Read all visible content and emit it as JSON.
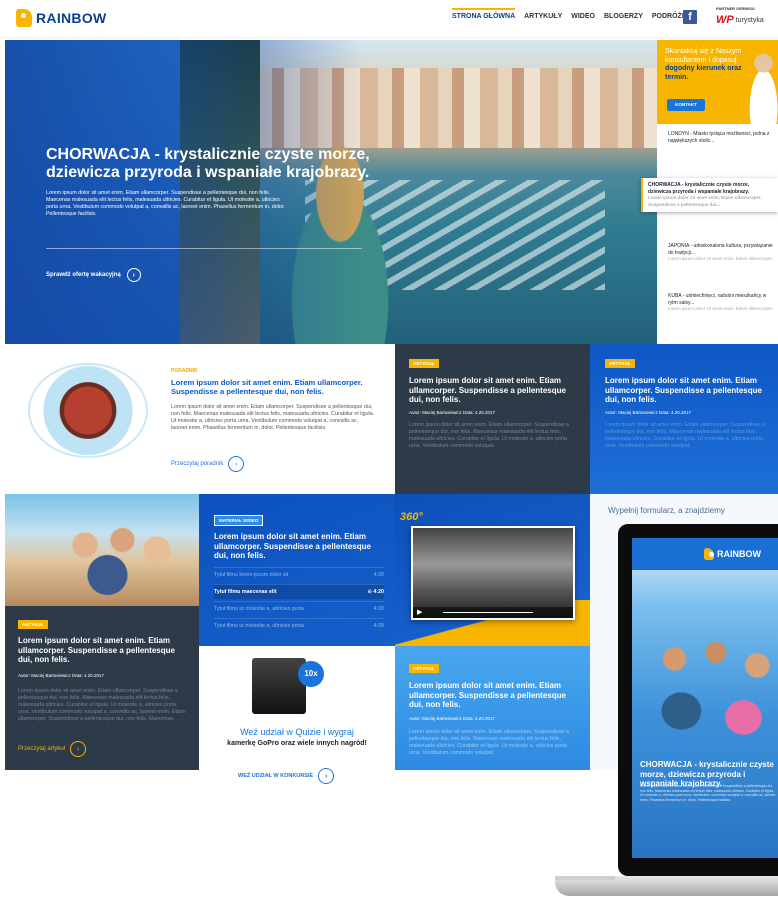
{
  "header": {
    "brand": "RAINBOW",
    "nav": [
      "STRONA GŁÓWNA",
      "ARTYKUŁY",
      "WIDEO",
      "BLOGERZY",
      "PODRÓŻE"
    ],
    "facebook": "f",
    "partner_label": "PARTNER SERWISU",
    "partner_logo": "WP",
    "partner_name": "turystyka"
  },
  "hero": {
    "title": "CHORWACJA - krystalicznie czyste morze, dziewicza przyroda i wspaniałe krajobrazy.",
    "text": "Lorem ipsum dolor sit amet enim. Etiam ullamcorper. Suspendisse a pellentesque dui, non felis. Maecenas malesuada elit lectus felis, malesuada ultricies. Curabitur et ligula. Ut molestie a, ultricies porta urna. Vestibulum commodo volutpat a, convallis ac, laoreet enim. Phasellus fermentum in, dolor. Pellentesque facilisis.",
    "cta": "Sprawdź ofertę wakacyjną",
    "arrow": "›"
  },
  "side": {
    "promo_line1": "Skontaktuj się z Naszym konsultantem i dopasuj",
    "promo_bold": "dogodny kierunek oraz termin.",
    "contact_button": "KONTAKT",
    "items": [
      {
        "title": "LONDYN - Miasto tysiąca możliwości, jedna z największych stolic...",
        "text": ""
      },
      {
        "title": "CHORWACJA - krystalicznie czyste morze, dziewicza przyroda i wspaniałe krajobrazy.",
        "text": "Lorem ipsum dolor sit amet enim. Etiam ullamcorper. Suspendisse a pellentesque dui..."
      },
      {
        "title": "JAPONIA - udoskonalona kultura, przywiązanie do tradycji...",
        "text": "Lorem ipsum dolor sit amet enim. Etiam ullamcorper."
      },
      {
        "title": "KUBA - uśmiechnięci, radośni mieszkańcy w rytm salsy...",
        "text": "Lorem ipsum dolor sit amet enim. Etiam ullamcorper."
      }
    ]
  },
  "guide": {
    "tag": "PORADNIK",
    "title": "Lorem ipsum dolor sit amet enim. Etiam ullamcorper. Suspendisse a pellentesque dui, non felis.",
    "text": "Lorem ipsum dolor sit amet enim. Etiam ullamcorper. Suspendisse a pellentesque dui, non felis. Maecenas malesuada elit lectus felis, malesuada ultricies. Curabitur et ligula. Ut molestie a, ultricies porta urna. Vestibulum commodo volutpat a, convallis ac, laoreet enim. Phasellus fermentum in, dolor. Pellentesque facilisis.",
    "link": "Przeczytaj poradnik",
    "arrow": "›"
  },
  "article": {
    "tag": "ARTYKUŁ",
    "title": "Lorem ipsum dolor sit amet enim. Etiam ullamcorper. Suspendisse a pellentesque dui, non felis.",
    "meta": "Autor: Maciej Bartosiewicz    Data: 4.20.2017",
    "text": "Lorem ipsum dolor sit amet enim. Etiam ullamcorper. Suspendisse a pellentesque dui, non felis. Maecenas malesuada elit lectus felis, malesuada ultricies. Curabitur et ligula. Ut molestie a, ultricies porta urna. Vestibulum commodo volutpat.",
    "text_long": "Lorem ipsum dolor sit amet enim. Etiam ullamcorper. Suspendisse a pellentesque dui, non felis. Maecenas malesuada elit lectus felis, malesuada ultricies. Curabitur et ligula. Ut molestie a, ultricies porta urna. Vestibulum commodo volutpat a, convallis ac, laoreet enim. Etiam ullamcorper. Suspendisse a pellentesque dui, non felis. Maecenas.",
    "link": "Przeczytaj artykuł",
    "arrow": "›"
  },
  "video": {
    "tag": "MATERIAŁ WIDEO",
    "title": "Lorem ipsum dolor sit amet enim. Etiam ullamcorper. Suspendisse a pellentesque dui, non felis.",
    "list": [
      {
        "title": "Tytuł filmu lorem ipsum dolor sit",
        "time": "4:20"
      },
      {
        "title": "Tytuł filmu maecenas elit",
        "time": "4:20"
      },
      {
        "title": "Tytuł filmu ut molestie a, ultricies porta",
        "time": "4:20"
      },
      {
        "title": "Tytuł filmu ut molestie a, ultricies porta",
        "time": "4:20"
      }
    ],
    "badge_360": "360°",
    "play_icon": "▶",
    "play_indicator": "⊙"
  },
  "form": {
    "title": "Wypełnij formularz, a znajdziemy"
  },
  "quiz": {
    "badge": "10x",
    "line1": "Weź udział w Quizie i wygraj",
    "line2": "kamerkę GoPro oraz wiele innych nagród!",
    "link": "WEŹ UDZIAŁ W KONKURSIE",
    "arrow": "›"
  },
  "laptop": {
    "brand": "RAINBOW",
    "title": "CHORWACJA - krystalicznie czyste morze, dziewicza przyroda i wspaniałe krajobrazy.",
    "text": "Lorem ipsum dolor sit amet enim. Etiam ullamcorper. Suspendisse a pellentesque dui, non felis. Maecenas malesuada elit lectus felis, malesuada ultricies. Curabitur et ligula. Ut molestie a, ultricies porta urna. Vestibulum commodo volutpat a, convallis ac, laoreet enim. Phasellus fermentum in, dolor. Pellentesque facilisis."
  },
  "colors": {
    "brand_blue": "#0b3f8f",
    "accent_yellow": "#f7b500",
    "link_blue": "#1a74d9",
    "dark_card": "#2d3a48"
  }
}
